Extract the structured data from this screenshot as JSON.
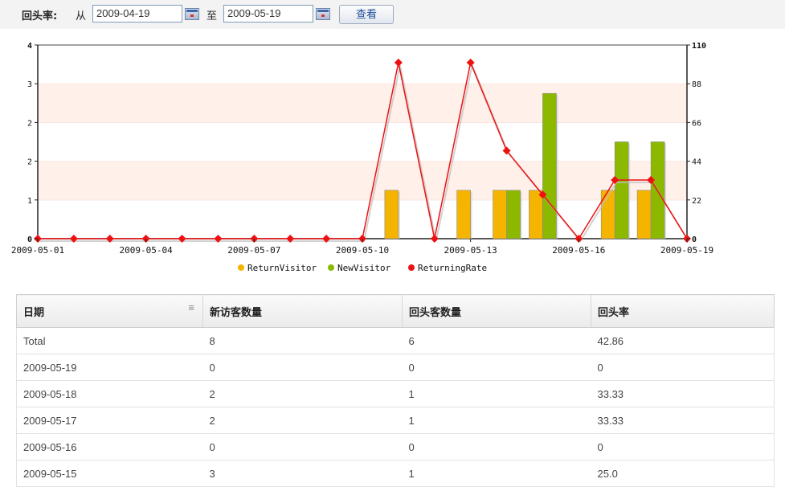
{
  "filter": {
    "label": "回头率:",
    "from_label": "从",
    "to_label": "至",
    "start_date": "2009-04-19",
    "end_date": "2009-05-19",
    "query_button": "查看"
  },
  "colors": {
    "return_visitor": "#f5b400",
    "new_visitor": "#8cb800",
    "returning_rate": "#ee1111",
    "band": "#fff0ea"
  },
  "chart_data": {
    "type": "bar",
    "x": [
      "2009-05-01",
      "2009-05-02",
      "2009-05-03",
      "2009-05-04",
      "2009-05-05",
      "2009-05-06",
      "2009-05-07",
      "2009-05-08",
      "2009-05-09",
      "2009-05-10",
      "2009-05-11",
      "2009-05-12",
      "2009-05-13",
      "2009-05-14",
      "2009-05-15",
      "2009-05-16",
      "2009-05-17",
      "2009-05-18",
      "2009-05-19"
    ],
    "xtick_labels": [
      "2009-05-01",
      "2009-05-04",
      "2009-05-07",
      "2009-05-10",
      "2009-05-13",
      "2009-05-16",
      "2009-05-19"
    ],
    "series": [
      {
        "name": "ReturnVisitor",
        "type": "bar",
        "axis": "left",
        "values": [
          0,
          0,
          0,
          0,
          0,
          0,
          0,
          0,
          0,
          0,
          1,
          0,
          1,
          1,
          1,
          0,
          1,
          1,
          0
        ]
      },
      {
        "name": "NewVisitor",
        "type": "bar",
        "axis": "left",
        "values": [
          0,
          0,
          0,
          0,
          0,
          0,
          0,
          0,
          0,
          0,
          0,
          0,
          0,
          1,
          3,
          0,
          2,
          2,
          0
        ]
      },
      {
        "name": "ReturningRate",
        "type": "line",
        "axis": "right",
        "values": [
          0,
          0,
          0,
          0,
          0,
          0,
          0,
          0,
          0,
          0,
          100,
          0,
          100,
          50,
          25,
          0,
          33.33,
          33.33,
          0
        ]
      }
    ],
    "yticks_left": [
      "0",
      "1",
      "2",
      "2",
      "3",
      "4"
    ],
    "yticks_right": [
      "0",
      "22",
      "44",
      "66",
      "88",
      "110"
    ],
    "ylim_left": [
      0,
      4
    ],
    "ylim_right": [
      0,
      110
    ],
    "legend_position": "bottom",
    "grid": "alternating horizontal bands"
  },
  "table": {
    "columns": [
      "日期",
      "新访客数量",
      "回头客数量",
      "回头率"
    ],
    "rows": [
      [
        "Total",
        "8",
        "6",
        "42.86"
      ],
      [
        "2009-05-19",
        "0",
        "0",
        "0"
      ],
      [
        "2009-05-18",
        "2",
        "1",
        "33.33"
      ],
      [
        "2009-05-17",
        "2",
        "1",
        "33.33"
      ],
      [
        "2009-05-16",
        "0",
        "0",
        "0"
      ],
      [
        "2009-05-15",
        "3",
        "1",
        "25.0"
      ]
    ]
  }
}
